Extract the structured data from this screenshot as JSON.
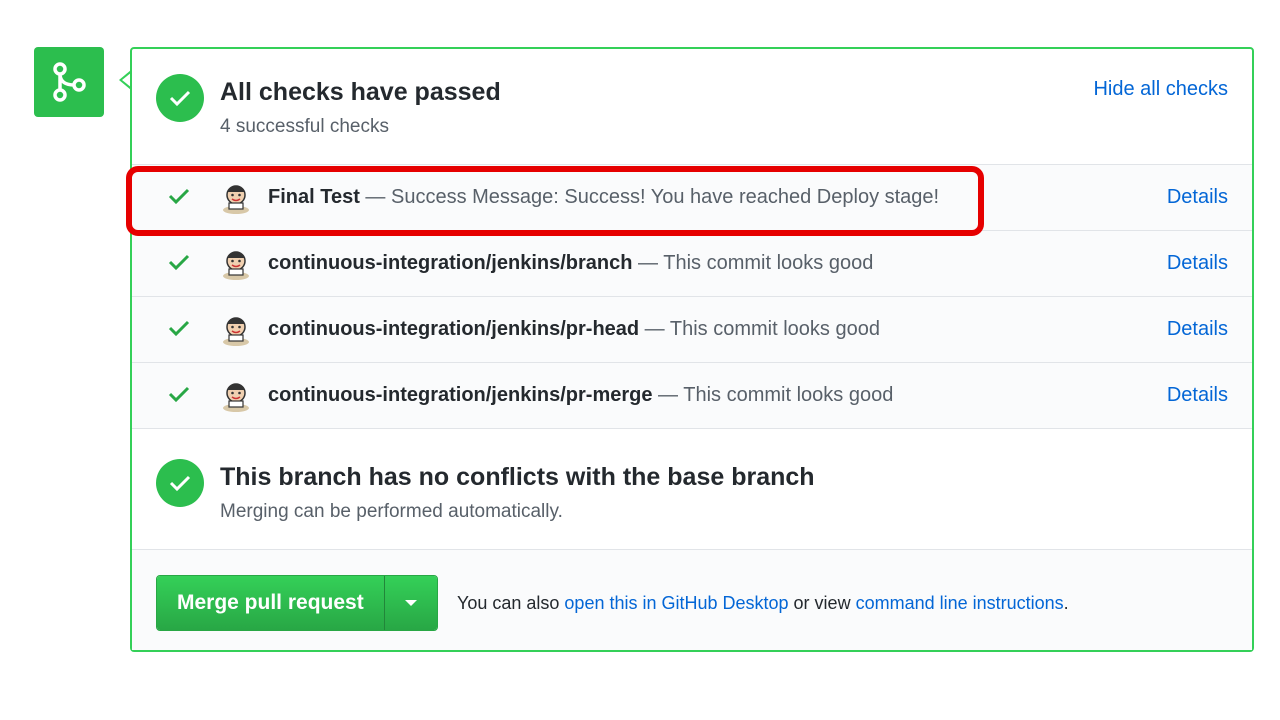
{
  "status": {
    "checks_title": "All checks have passed",
    "checks_subtitle": "4 successful checks",
    "hide_link": "Hide all checks"
  },
  "checks": [
    {
      "name": "Final Test",
      "separator": " — ",
      "description": "Success Message: Success! You have reached Deploy stage!",
      "details": "Details"
    },
    {
      "name": "continuous-integration/jenkins/branch",
      "separator": " — ",
      "description": "This commit looks good",
      "details": "Details"
    },
    {
      "name": "continuous-integration/jenkins/pr-head",
      "separator": " — ",
      "description": "This commit looks good",
      "details": "Details"
    },
    {
      "name": "continuous-integration/jenkins/pr-merge",
      "separator": " — ",
      "description": "This commit looks good",
      "details": "Details"
    }
  ],
  "conflicts": {
    "title": "This branch has no conflicts with the base branch",
    "subtitle": "Merging can be performed automatically."
  },
  "merge": {
    "button_label": "Merge pull request",
    "note_prefix": "You can also ",
    "desktop_link": "open this in GitHub Desktop",
    "note_middle": " or view ",
    "cli_link": "command line instructions",
    "note_suffix": "."
  },
  "colors": {
    "success_green": "#2cbe4e",
    "link_blue": "#0366d6",
    "highlight_red": "#e60000"
  },
  "icons": {
    "merge": "git-merge-icon",
    "check": "check-icon",
    "avatar": "jenkins-avatar-icon",
    "caret": "triangle-down-icon"
  }
}
